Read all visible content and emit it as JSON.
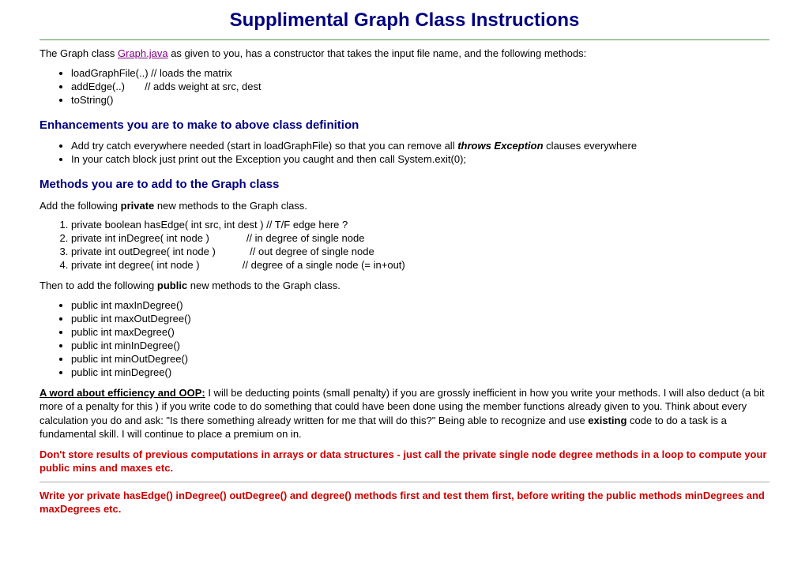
{
  "title": "Supplimental Graph Class Instructions",
  "intro": {
    "pre": "The Graph class ",
    "link": "Graph.java",
    "post": " as given to you, has a constructor that takes the input file name, and the following methods:"
  },
  "given_methods": [
    "loadGraphFile(..) // loads the matrix",
    "addEdge(..)       // adds weight at src, dest",
    "toString()"
  ],
  "enh_heading": "Enhancements you are to  make to above class definition",
  "enh_items": {
    "a_pre": "Add try catch everywhere needed (start in loadGraphFile) so that you can remove all ",
    "a_bold": "throws Exception",
    "a_post": " clauses everywhere",
    "b": "In your catch block just print out the Exception you caught and then call System.exit(0);"
  },
  "methods_heading": "Methods you are to add to the Graph class",
  "private_intro": {
    "pre": "Add the following ",
    "bold": "private",
    "post": " new methods to the Graph class."
  },
  "private_methods": [
    "private boolean hasEdge( int src, int dest ) // T/F edge here ?",
    "private int inDegree( int node )             // in degree of single node",
    "private int outDegree( int node )            // out degree of single node",
    "private int degree( int node )               // degree of a single node (= in+out)"
  ],
  "public_intro": {
    "pre": "Then to add the following ",
    "bold": "public",
    "post": " new methods to the Graph class."
  },
  "public_methods": [
    "public int maxInDegree()",
    "public int maxOutDegree()",
    "public int maxDegree()",
    "public int minInDegree()",
    "public int minOutDegree()",
    "public int minDegree()"
  ],
  "efficiency": {
    "label": "A word about efficiency and OOP:",
    "body_pre": "   I will be deducting points (small penalty) if you are grossly inefficient in how you write your methods. I will also deduct (a bit more of a penalty for this ) if you write code to do something that could have been done using the member functions already given to you.  Think about every calculation you do and ask: \"Is there something already written for me that will do this?\" Being able to recognize and use ",
    "body_bold": "existing",
    "body_post": " code to do a task is a fundamental skill. I will continue to place a premium on in."
  },
  "red1": "Don't store results of previous computations in arrays or data structures - just call the private single node degree methods in a loop to compute your public mins and maxes etc.",
  "red2": "Write yor private hasEdge() inDegree() outDegree() and degree() methods first and test them first, before writing the public methods minDegrees and maxDegrees etc."
}
